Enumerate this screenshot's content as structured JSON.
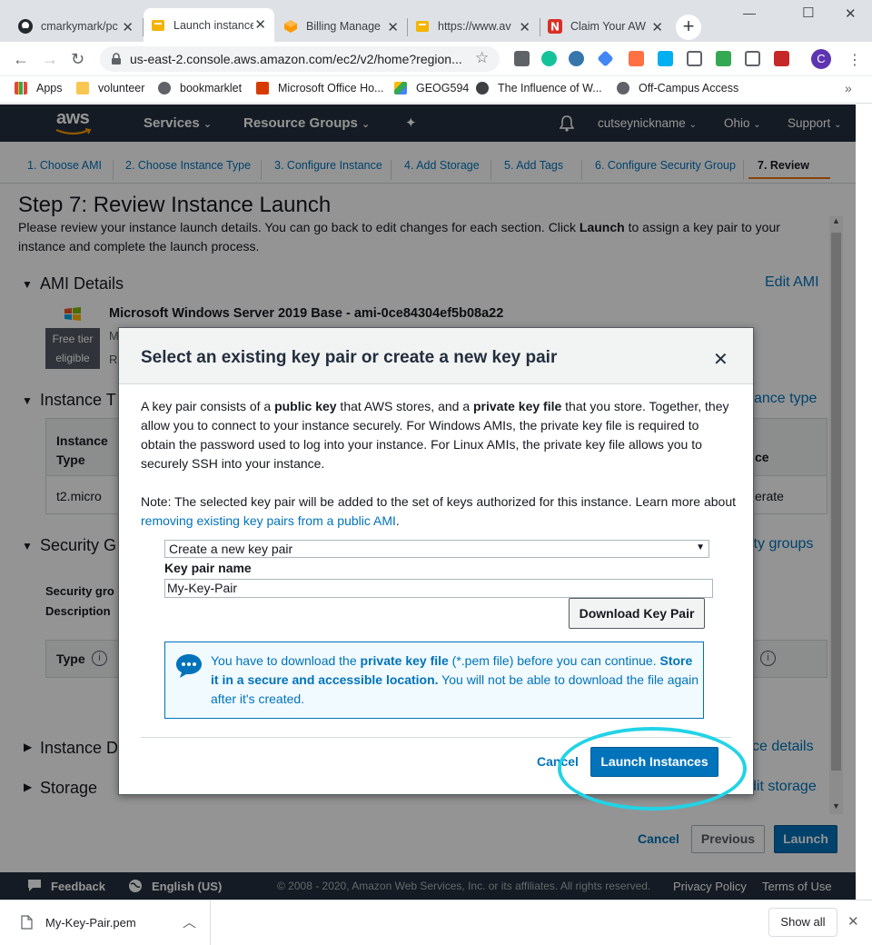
{
  "browser": {
    "tabs": [
      {
        "title": "cmarkymark/pc",
        "favicon_color": "#24292e",
        "favicon": "github-icon"
      },
      {
        "title": "Launch instance",
        "favicon_color": "#f4b400",
        "favicon": "aws-box-icon"
      },
      {
        "title": "Billing Manage",
        "favicon_color": "#ff9900",
        "favicon": "aws-cube-icon"
      },
      {
        "title": "https://www.av",
        "favicon_color": "#f4b400",
        "favicon": "aws-box-icon"
      },
      {
        "title": "Claim Your AW",
        "favicon_color": "#d93025",
        "favicon": "n-icon"
      }
    ],
    "new_tab": "+",
    "url": "us-east-2.console.aws.amazon.com/ec2/v2/home?region...",
    "profile_initial": "C",
    "bookmarks": [
      "Apps",
      "volunteer",
      "bookmarklet",
      "Microsoft Office Ho...",
      "GEOG594",
      "The Influence of W...",
      "Off-Campus Access"
    ],
    "bookmarks_more": "»"
  },
  "aws": {
    "logo": "aws",
    "nav": {
      "services": "Services",
      "resource_groups": "Resource Groups",
      "user": "cutseynickname",
      "region": "Ohio",
      "support": "Support"
    },
    "steps": [
      "1. Choose AMI",
      "2. Choose Instance Type",
      "3. Configure Instance",
      "4. Add Storage",
      "5. Add Tags",
      "6. Configure Security Group",
      "7. Review"
    ],
    "page": {
      "title": "Step 7: Review Instance Launch",
      "intro_before": "Please review your instance launch details. You can go back to edit changes for each section. Click ",
      "intro_bold": "Launch",
      "intro_after": " to assign a key pair to your instance and complete the launch process.",
      "ami_section": "AMI Details",
      "edit_ami": "Edit AMI",
      "ami_name": "Microsoft Windows Server 2019 Base - ami-0ce84304ef5b08a22",
      "free_tier": "Free tier",
      "eligible": "eligible",
      "ami_line_m": "M",
      "ami_line_r": "R",
      "instance_section": "Instance T",
      "edit_instance_type": "ance type",
      "col_instance": "Instance",
      "col_type": "Type",
      "col_ce": "ce",
      "row_instance": "t2.micro",
      "row_erate": "erate",
      "security_section": "Security G",
      "edit_security": "ity groups",
      "sg_label": "Security gro",
      "desc_label": "Description",
      "type_col": "Type",
      "instance_details": "Instance D",
      "edit_details": "ce details",
      "storage": "Storage",
      "edit_storage": "dit storage"
    },
    "buttons": {
      "cancel": "Cancel",
      "previous": "Previous",
      "launch": "Launch"
    },
    "footer": {
      "feedback": "Feedback",
      "language": "English (US)",
      "copyright": "© 2008 - 2020, Amazon Web Services, Inc. or its affiliates. All rights reserved.",
      "privacy": "Privacy Policy",
      "terms": "Terms of Use"
    }
  },
  "modal": {
    "title": "Select an existing key pair or create a new key pair",
    "close": "✕",
    "p1_a": "A key pair consists of a ",
    "p1_b": "public key",
    "p1_c": " that AWS stores, and a ",
    "p1_d": "private key file",
    "p1_e": " that you store. Together, they allow you to connect to your instance securely. For Windows AMIs, the private key file is required to obtain the password used to log into your instance. For Linux AMIs, the private key file allows you to securely SSH into your instance.",
    "note": "Note: The selected key pair will be added to the set of keys authorized for this instance. Learn more about ",
    "note_link": "removing existing key pairs from a public AMI",
    "note_end": ".",
    "select_value": "Create a new key pair",
    "key_pair_label": "Key pair name",
    "key_pair_value": "My-Key-Pair",
    "download_button": "Download Key Pair",
    "info_a": "You have to download the ",
    "info_b": "private key file",
    "info_c": " (*.pem file) before you can continue. ",
    "info_d": "Store it in a secure and accessible location.",
    "info_e": " You will not be able to download the file again after it's created.",
    "cancel": "Cancel",
    "launch": "Launch Instances"
  },
  "download_bar": {
    "file": "My-Key-Pair.pem",
    "show_all": "Show all",
    "close": "✕"
  },
  "colors": {
    "aws_nav": "#232f3e",
    "link": "#0073bb",
    "primary": "#0073bb",
    "highlight": "#22d3e6",
    "active_step": "#ec7211"
  }
}
